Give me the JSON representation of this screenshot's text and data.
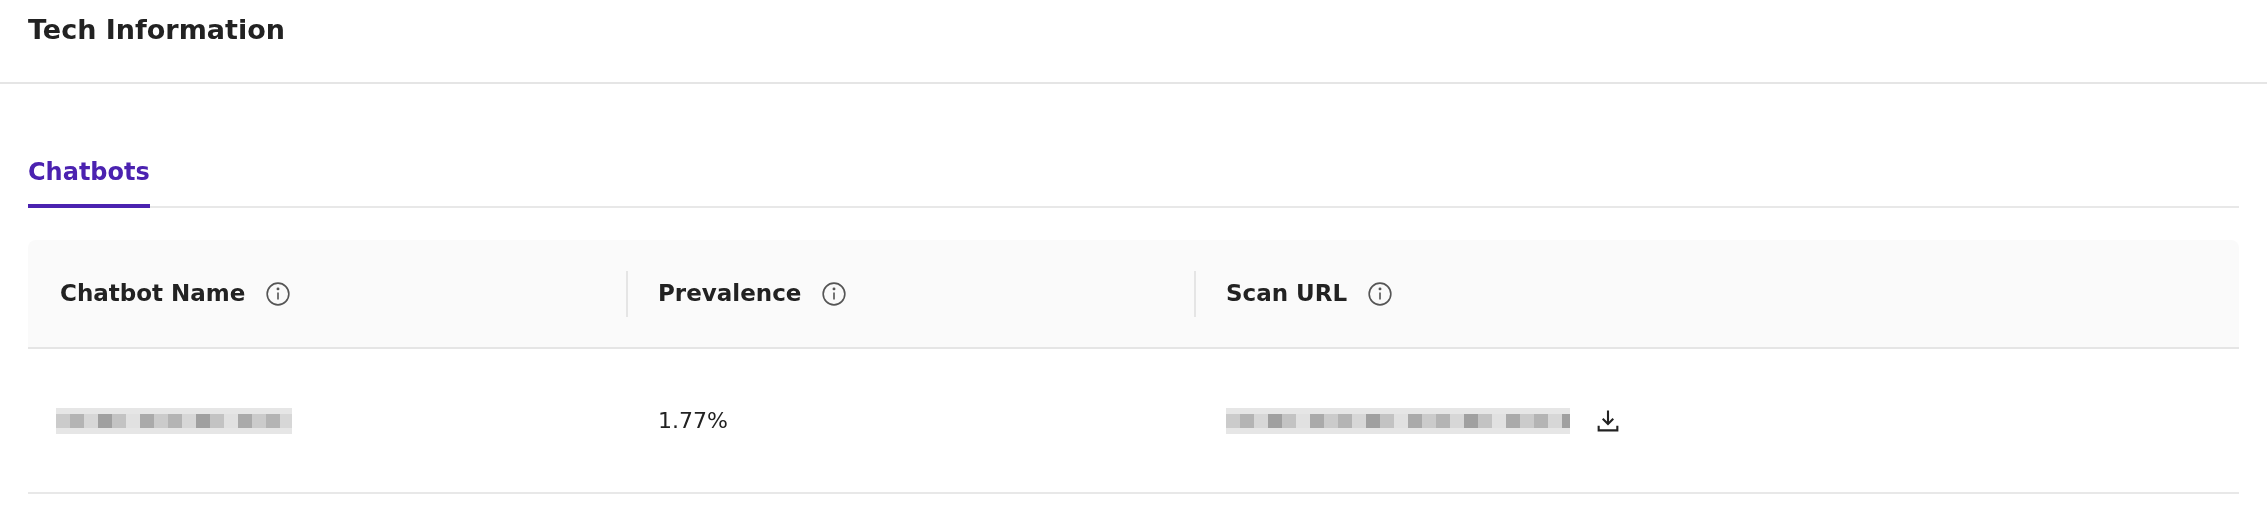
{
  "title": "Tech Information",
  "tabs": [
    {
      "label": "Chatbots",
      "selected": true
    }
  ],
  "table": {
    "columns": [
      {
        "label": "Chatbot Name",
        "info": true
      },
      {
        "label": "Prevalence",
        "info": true
      },
      {
        "label": "Scan URL",
        "info": true
      }
    ],
    "rows": [
      {
        "cells": [
          {
            "kind": "redacted"
          },
          {
            "kind": "text",
            "text": "1.77%"
          },
          {
            "kind": "redacted",
            "download": true
          }
        ]
      }
    ]
  }
}
